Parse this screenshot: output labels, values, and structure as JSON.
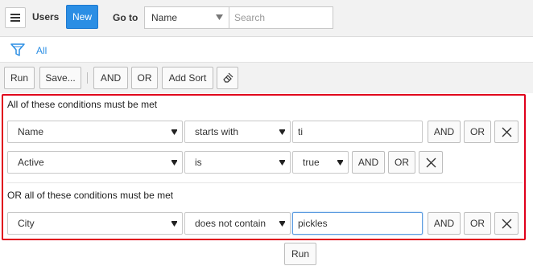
{
  "header": {
    "title": "Users",
    "new_label": "New",
    "goto_label": "Go to",
    "goto_selected": "Name",
    "search_placeholder": "Search"
  },
  "filter": {
    "label": "All",
    "icon": "filter-icon"
  },
  "toolbar": {
    "run_label": "Run",
    "save_label": "Save...",
    "and_label": "AND",
    "or_label": "OR",
    "add_sort_label": "Add Sort",
    "clear_icon": "eraser-icon"
  },
  "groups": [
    {
      "label": "All of these conditions must be met",
      "conditions": [
        {
          "field": "Name",
          "operator": "starts with",
          "value": "ti"
        },
        {
          "field": "Active",
          "operator": "is",
          "value": "true"
        }
      ]
    },
    {
      "label": "OR all of these conditions must be met",
      "conditions": [
        {
          "field": "City",
          "operator": "does not contain",
          "value": "pickles"
        }
      ]
    }
  ],
  "condition_buttons": {
    "and_label": "AND",
    "or_label": "OR",
    "remove_icon": "close-icon"
  },
  "footer": {
    "run_label": "Run"
  },
  "colors": {
    "accent": "#2b8ee4",
    "highlight_border": "#e0001b"
  }
}
